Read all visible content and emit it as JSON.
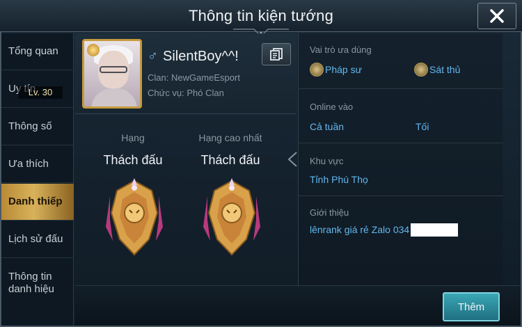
{
  "header": {
    "title": "Thông tin kiện tướng",
    "close_icon": "close-icon"
  },
  "sidebar": {
    "items": [
      {
        "label": "Tổng quan"
      },
      {
        "label": "Uy tín"
      },
      {
        "label": "Thông số"
      },
      {
        "label": "Ưa thích"
      },
      {
        "label": "Danh thiếp"
      },
      {
        "label": "Lịch sử đấu"
      },
      {
        "label": "Thông tin\ndanh hiệu"
      }
    ],
    "active_index": 4
  },
  "profile": {
    "name": "SilentBoy^^!",
    "gender_symbol": "♂",
    "clan": "Clan: NewGameEsport",
    "role": "Chức vụ: Phó Clan",
    "level": "Lv. 30"
  },
  "ranks": {
    "current_label": "Hạng",
    "current_value": "Thách đấu",
    "highest_label": "Hạng cao nhất",
    "highest_value": "Thách đấu"
  },
  "details": {
    "preferred_role_title": "Vai trò ưa dùng",
    "roles": [
      "Pháp sư",
      "Sát thủ"
    ],
    "online_title": "Online vào",
    "online_values": [
      "Cả tuần",
      "Tối"
    ],
    "region_title": "Khu vực",
    "region_value": "Tỉnh Phú Thọ",
    "intro_title": "Giới thiệu",
    "intro_value": "lênrank giá rẻ Zalo 034"
  },
  "footer": {
    "more_button": "Thêm"
  },
  "colors": {
    "accent_blue": "#63b8f0",
    "active_gold": "#d8b25a",
    "button_teal": "#2a8ea0"
  }
}
